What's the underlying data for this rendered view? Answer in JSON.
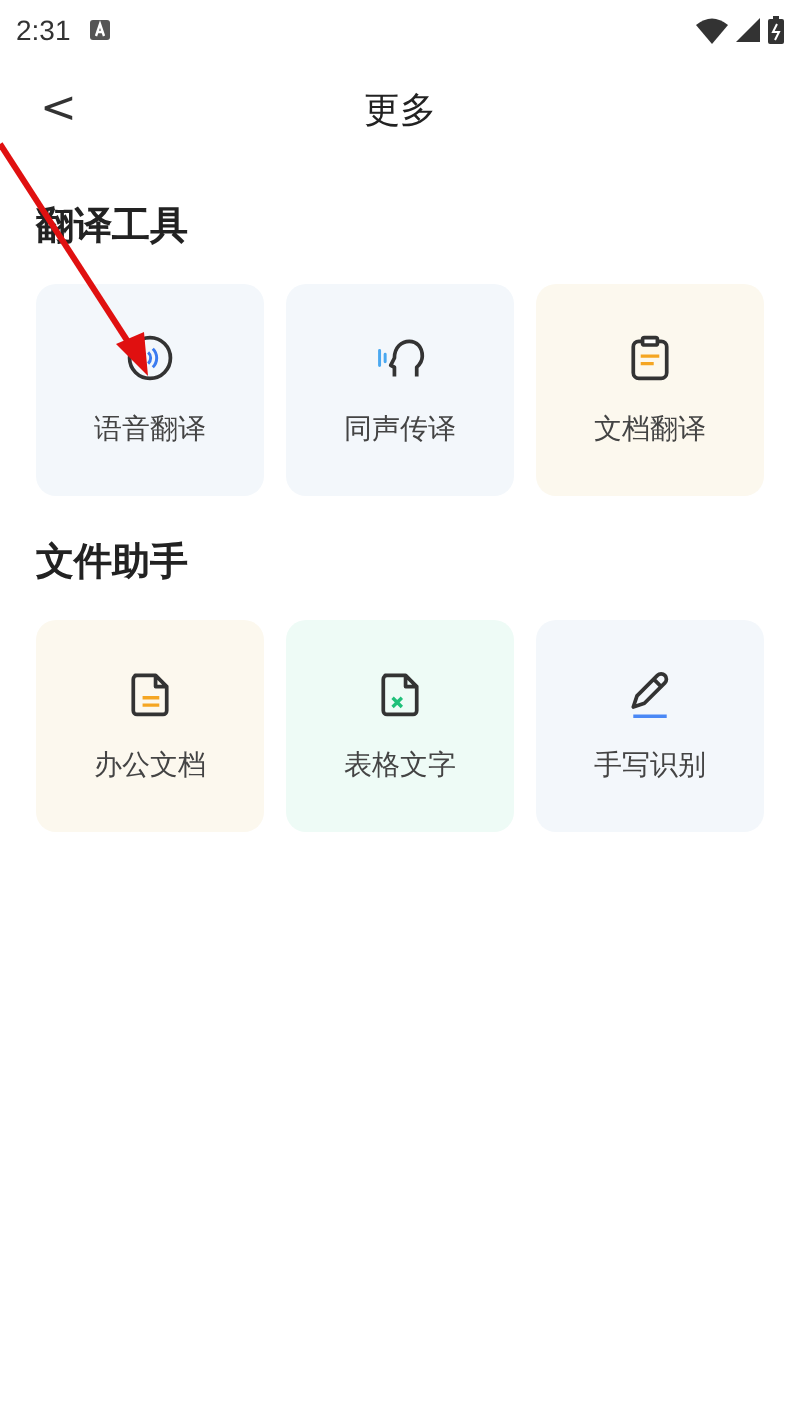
{
  "status_bar": {
    "time": "2:31"
  },
  "header": {
    "back": "<",
    "title": "更多"
  },
  "sections": [
    {
      "title": "翻译工具",
      "items": [
        {
          "label": "语音翻译",
          "kind": "voice",
          "color": "#f3f7fb"
        },
        {
          "label": "同声传译",
          "kind": "speech",
          "color": "#f3f7fb"
        },
        {
          "label": "文档翻译",
          "kind": "clipboard",
          "color": "#fcf8ee"
        }
      ]
    },
    {
      "title": "文件助手",
      "items": [
        {
          "label": "办公文档",
          "kind": "office",
          "color": "#fcf8ee"
        },
        {
          "label": "表格文字",
          "kind": "sheet",
          "color": "#eefbf6"
        },
        {
          "label": "手写识别",
          "kind": "pen",
          "color": "#f3f7fb"
        }
      ]
    }
  ]
}
